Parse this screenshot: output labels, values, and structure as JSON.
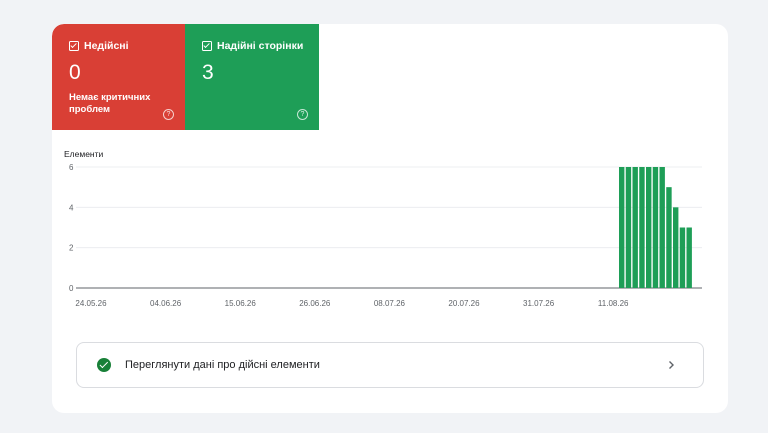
{
  "tiles": {
    "invalid": {
      "label": "Недійсні",
      "count": "0",
      "sub": "Немає критичних проблем",
      "help": "?",
      "color": "#d93f35"
    },
    "valid": {
      "label": "Надійні сторінки",
      "count": "3",
      "help": "?",
      "color": "#1e9e57"
    }
  },
  "chart_data": {
    "type": "bar",
    "ylabel": "Елементи",
    "ylim": [
      0,
      6
    ],
    "yticks": [
      "0",
      "2",
      "4",
      "6"
    ],
    "xtick_labels": [
      "24.05.26",
      "04.06.26",
      "15.06.26",
      "26.06.26",
      "08.07.26",
      "20.07.26",
      "31.07.26",
      "11.08.26"
    ],
    "series": [
      {
        "color": "#1e9e57",
        "values": [
          6,
          6,
          6,
          6,
          6,
          6,
          6,
          5,
          4,
          3,
          3
        ]
      }
    ],
    "grid": true
  },
  "details_row": {
    "label": "Переглянути дані про дійсні елементи"
  }
}
